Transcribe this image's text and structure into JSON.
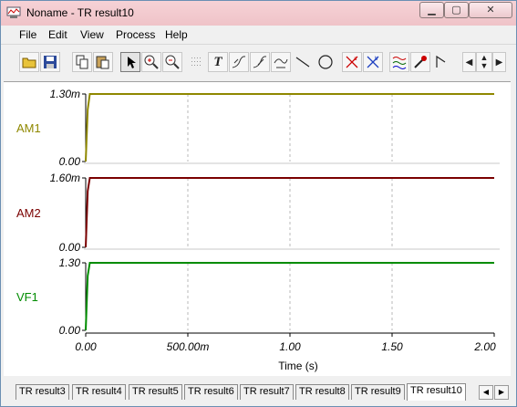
{
  "window": {
    "title": "Noname - TR result10",
    "minimize": "▁",
    "maximize": "▢",
    "close": "✕"
  },
  "menu": [
    "File",
    "Edit",
    "View",
    "Process",
    "Help"
  ],
  "toolbar": {
    "text_tool": "T"
  },
  "chart_data": [
    {
      "type": "line",
      "label": "AM1",
      "color": "#8f8800",
      "ylim": [
        0,
        0.0013
      ],
      "ytick_labels": [
        "1.30m",
        "0.00"
      ],
      "x": [
        0,
        0.01,
        0.02,
        2.0
      ],
      "y": [
        0,
        0.001,
        0.0013,
        0.0013
      ]
    },
    {
      "type": "line",
      "label": "AM2",
      "color": "#7a0000",
      "ylim": [
        0,
        0.0016
      ],
      "ytick_labels": [
        "1.60m",
        "0.00"
      ],
      "x": [
        0,
        0.01,
        0.02,
        2.0
      ],
      "y": [
        0,
        0.0013,
        0.0016,
        0.0016
      ]
    },
    {
      "type": "line",
      "label": "VF1",
      "color": "#008c00",
      "ylim": [
        0,
        1.3
      ],
      "ytick_labels": [
        "1.30",
        "0.00"
      ],
      "x": [
        0,
        0.01,
        0.02,
        2.0
      ],
      "y": [
        0,
        1.05,
        1.3,
        1.3
      ]
    }
  ],
  "x_axis": {
    "xlabel": "Time (s)",
    "xlim": [
      0,
      2.0
    ],
    "ticks": [
      0,
      0.5,
      1.0,
      1.5,
      2.0
    ],
    "tick_labels": [
      "0.00",
      "500.00m",
      "1.00",
      "1.50",
      "2.00"
    ]
  },
  "tabs": [
    "TR result3",
    "TR result4",
    "TR result5",
    "TR result6",
    "TR result7",
    "TR result8",
    "TR result9",
    "TR result10"
  ],
  "active_tab": "TR result10",
  "nav": {
    "prev": "◀",
    "next": "▶"
  }
}
